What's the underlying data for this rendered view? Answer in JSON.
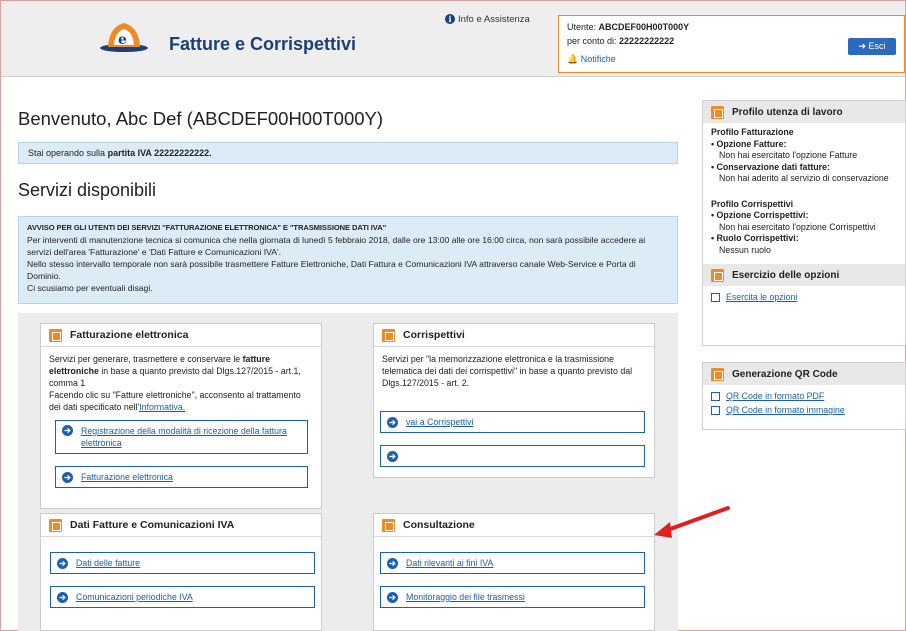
{
  "header": {
    "app_title": "Fatture e Corrispettivi",
    "info_link": "Info e Assistenza",
    "user_label": "Utente:",
    "user_value": "ABCDEF00H00T000Y",
    "conto_label": "per conto di:",
    "conto_value": "22222222222",
    "notifiche": "Notifiche",
    "esci": "Esci"
  },
  "main": {
    "welcome": "Benvenuto, Abc Def (ABCDEF00H00T000Y)",
    "partita_prefix": "Stai operando sulla",
    "partita_bold": "partita IVA 22222222222.",
    "servizi_title": "Servizi disponibili",
    "avviso_title": "AVVISO PER GLI UTENTI DEI SERVIZI \"FATTURAZIONE ELETTRONICA\" E \"TRASMISSIONE DATI IVA\"",
    "avviso_p1": "Per interventi di manutenzione tecnica si comunica che nella giornata di lunedì 5 febbraio 2018, dalle ore 13:00 alle ore 16:00 circa, non sarà possibile accedere ai servizi dell'area 'Fatturazione' e 'Dati Fatture e Comunicazioni IVA'.",
    "avviso_p2": "Nello stesso intervallo temporale non sarà possibile trasmettere Fatture Elettroniche, Dati Fattura e Comunicazioni IVA attraverso canale Web-Service e Porta di Dominio.",
    "avviso_p3": "Ci scusiamo per eventuali disagi."
  },
  "cards": {
    "fatturazione": {
      "title": "Fatturazione elettronica",
      "desc_a": "Servizi per generare, trasmettere e conservare le ",
      "desc_b": "fatture elettroniche",
      "desc_c": " in base a quanto previsto dal Dlgs.127/2015 - art.1, comma 1",
      "desc_d": "Facendo clic su \"Fatture elettroniche\", acconsento al trattamento dei dati specificato nell'",
      "desc_link": "Informativa.",
      "link1": "Registrazione della modalità di ricezione della fattura elettronica",
      "link2": "Fatturazione elettronica"
    },
    "corrispettivi": {
      "title": "Corrispettivi",
      "desc": "Servizi per \"la memorizzazione elettronica e la trasmissione telematica dei dati dei corrispettivi\" in base a quanto previsto dal Dlgs.127/2015 - art. 2.",
      "link1": "vai a Corrispettivi",
      "link2": ""
    },
    "dati_fatture": {
      "title": "Dati Fatture e Comunicazioni IVA",
      "link1": "Dati delle fatture",
      "link2": "Comunicazioni periodiche IVA"
    },
    "consultazione": {
      "title": "Consultazione",
      "link1": "Dati rilevanti ai fini IVA",
      "link2": "Monitoraggio dei file trasmessi"
    }
  },
  "sidebar": {
    "profilo_title": "Profilo utenza di lavoro",
    "profilo_fatt_h": "Profilo Fatturazione",
    "opz_fatt_label": "• Opzione Fatture:",
    "opz_fatt_val": "Non hai esercitato l'opzione Fatture",
    "cons_label": "• Conservazione dati fatture:",
    "cons_val": "Non hai aderito al servizio di conservazione",
    "profilo_corr_h": "Profilo Corrispettivi",
    "opz_corr_label": "• Opzione Corrispettivi:",
    "opz_corr_val": "Non hai esercitato l'opzione Corrispettivi",
    "ruolo_label": "• Ruolo Corrispettivi:",
    "ruolo_val": "Nessun ruolo",
    "esercizio_title": "Esercizio delle opzioni",
    "esercita_link": "Esercita le opzioni",
    "qr_title": "Generazione QR Code",
    "qr_pdf": "QR Code in formato PDF",
    "qr_img": "QR Code in formato immagine"
  },
  "colors": {
    "accent_orange": "#f08a24",
    "link_blue": "#1a5fb4",
    "title_blue": "#1b3f7a",
    "annotation_red": "#e02020"
  }
}
